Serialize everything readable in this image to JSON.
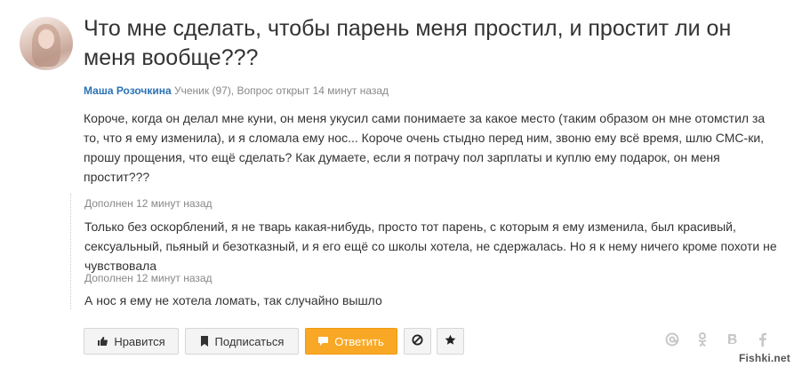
{
  "question": {
    "title": "Что мне сделать, чтобы парень меня простил, и простит ли он меня вообще???",
    "author": "Маша Розочкина",
    "meta_rest": " Ученик (97), Вопрос открыт 14 минут назад",
    "body": "Короче, когда он делал мне куни, он меня укусил сами понимаете за какое место (таким образом он мне отомстил за то, что я ему изменила), и я сломала ему нос... Короче очень стыдно перед ним, звоню ему всё время, шлю СМС-ки, прошу прощения, что ещё сделать? Как думаете, если я потрачу пол зарплаты и куплю ему подарок, он меня простит???"
  },
  "additions": [
    {
      "header": "Дополнен 12 минут назад",
      "text": "Только без оскорблений, я не тварь какая-нибудь, просто тот парень, с которым я ему изменила, был красивый, сексуальный, пьяный и безотказный, и я его ещё со школы хотела, не сдержалась. Но я к нему ничего кроме похоти не чувствовала"
    },
    {
      "header": "Дополнен 12 минут назад",
      "text": "А нос я ему не хотела ломать, так случайно вышло"
    }
  ],
  "toolbar": {
    "like_label": "Нравится",
    "subscribe_label": "Подписаться",
    "answer_label": "Ответить"
  },
  "share_icons": [
    "at-icon",
    "odnoklassniki-icon",
    "vk-icon",
    "facebook-icon"
  ],
  "colors": {
    "accent": "#f9a825",
    "link": "#2a72b5"
  },
  "watermark": "Fishki.net"
}
